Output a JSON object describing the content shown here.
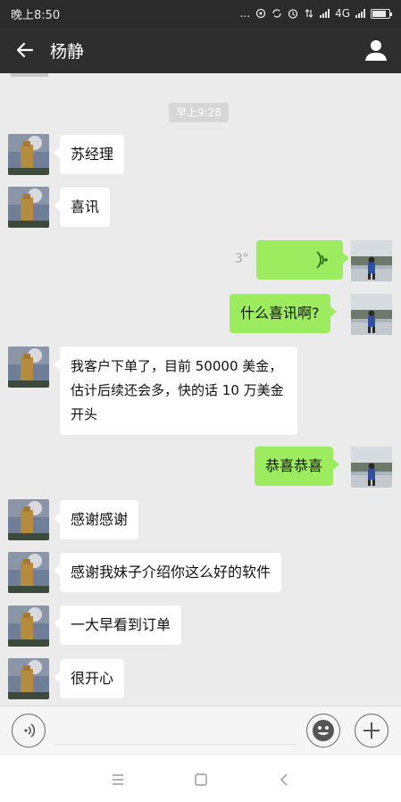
{
  "status_bar": {
    "time": "晚上8:50",
    "dots": "...",
    "network": "4G",
    "battery_level": 0.85,
    "icons": [
      "alarm-icon",
      "sync-icon",
      "clock-icon",
      "data-arrows-icon",
      "signal-icon",
      "battery-icon"
    ]
  },
  "header": {
    "title": "杨静",
    "back_icon": "back-arrow-icon",
    "profile_icon": "person-icon"
  },
  "chat": {
    "time_separator": "早上9:28",
    "messages": [
      {
        "side": "left",
        "text": "苏经理"
      },
      {
        "side": "left",
        "text": "喜讯"
      },
      {
        "side": "right",
        "type": "voice",
        "duration": "3\""
      },
      {
        "side": "right",
        "text": "什么喜讯啊?"
      },
      {
        "side": "left",
        "lines": [
          "我客户下单了，目前 50000 美金，",
          "估计后续还会多，快的话 10 万美金",
          "开头"
        ]
      },
      {
        "side": "right",
        "text": "恭喜恭喜"
      },
      {
        "side": "left",
        "text": "感谢感谢"
      },
      {
        "side": "left",
        "text": "感谢我妹子介绍你这么好的软件"
      },
      {
        "side": "left",
        "text": "一大早看到订单"
      },
      {
        "side": "left",
        "text": "很开心"
      }
    ]
  },
  "input_bar": {
    "voice_icon": "voice-input-icon",
    "emoji_icon": "emoji-icon",
    "plus_icon": "plus-icon"
  },
  "nav_bar": {
    "icons": [
      "menu-icon",
      "home-square-icon",
      "back-chevron-icon"
    ]
  },
  "colors": {
    "outgoing_bubble": "#9deb5f",
    "incoming_bubble": "#ffffff",
    "chat_background": "#ebebeb",
    "title_bar": "#2e2e2e"
  }
}
